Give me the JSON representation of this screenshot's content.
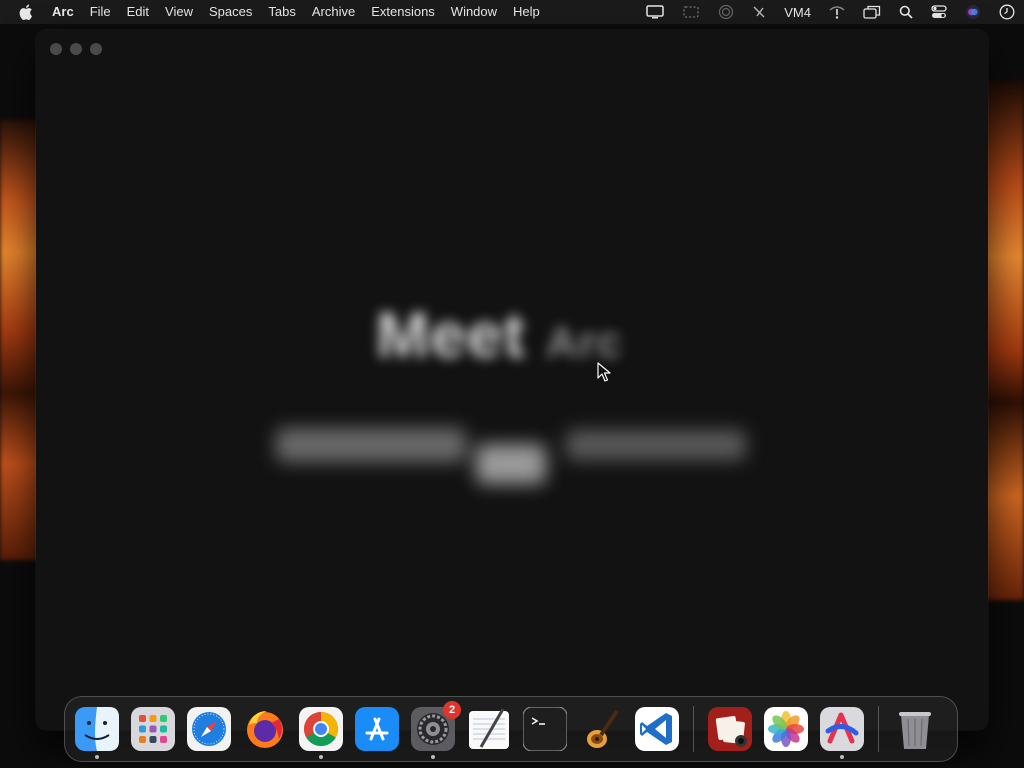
{
  "menubar": {
    "app_name": "Arc",
    "items": [
      "File",
      "Edit",
      "View",
      "Spaces",
      "Tabs",
      "Archive",
      "Extensions",
      "Window",
      "Help"
    ],
    "status": {
      "vm_label": "VM4",
      "icons": [
        "display-icon",
        "screen-mirror-icon",
        "airdrop-icon",
        "pen-slash-icon",
        "vm-label",
        "wifi-icon",
        "window-overlap-icon",
        "search-icon",
        "control-center-icon",
        "siri-icon",
        "clock-icon"
      ]
    }
  },
  "window": {
    "app": "Arc",
    "splash_title": "Meet",
    "splash_title_suffix": "Arc"
  },
  "dock": {
    "apps": [
      {
        "name": "Finder",
        "icon": "finder-icon",
        "running": true
      },
      {
        "name": "Launchpad",
        "icon": "launchpad-icon",
        "running": false
      },
      {
        "name": "Safari",
        "icon": "safari-icon",
        "running": false
      },
      {
        "name": "Firefox",
        "icon": "firefox-icon",
        "running": false
      },
      {
        "name": "Chrome",
        "icon": "chrome-icon",
        "running": true
      },
      {
        "name": "App Store",
        "icon": "app-store-icon",
        "running": false
      },
      {
        "name": "System Settings",
        "icon": "system-settings-icon",
        "running": true,
        "badge": "2"
      },
      {
        "name": "TextEdit",
        "icon": "textedit-icon",
        "running": false
      },
      {
        "name": "Terminal",
        "icon": "terminal-icon",
        "running": false
      },
      {
        "name": "GarageBand",
        "icon": "garageband-icon",
        "running": false
      },
      {
        "name": "Visual Studio Code",
        "icon": "vscode-icon",
        "running": false
      }
    ],
    "recent": [
      {
        "name": "Photo Booth",
        "icon": "photo-booth-icon",
        "running": false
      },
      {
        "name": "Photos",
        "icon": "photos-icon",
        "running": false
      },
      {
        "name": "Arc",
        "icon": "arc-icon",
        "running": true
      }
    ],
    "trash": {
      "name": "Trash",
      "icon": "trash-icon"
    }
  },
  "colors": {
    "menubar_bg": "#1b1b1b",
    "window_bg": "#121212",
    "badge": "#e0352b",
    "wallpaper_accent": "#e8882f"
  }
}
